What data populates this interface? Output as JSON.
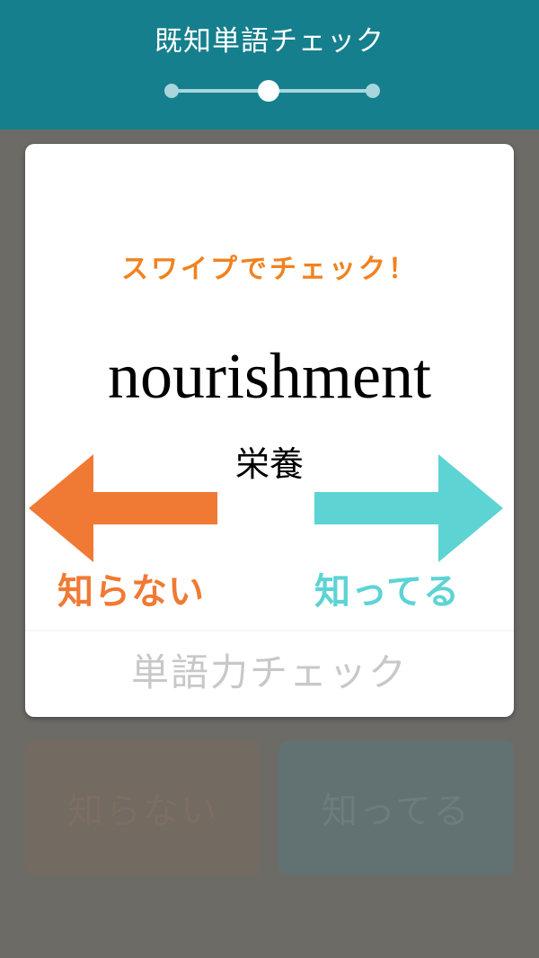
{
  "header": {
    "title": "既知単語チェック",
    "progress": {
      "current_step": 2,
      "total_steps": 3
    }
  },
  "card": {
    "hint": "スワイプでチェック！",
    "word": "nourishment",
    "meaning": "栄養",
    "left_label": "知らない",
    "right_label": "知ってる",
    "footer": "単語力チェック"
  },
  "buttons": {
    "unknown_label": "知らない",
    "known_label": "知ってる"
  },
  "colors": {
    "header": "#157f8d",
    "hint": "#f0821e",
    "left_arrow": "#f07a34",
    "right_arrow": "#5dd3d4"
  },
  "icons": {
    "left": "arrow-left-icon",
    "right": "arrow-right-icon"
  }
}
